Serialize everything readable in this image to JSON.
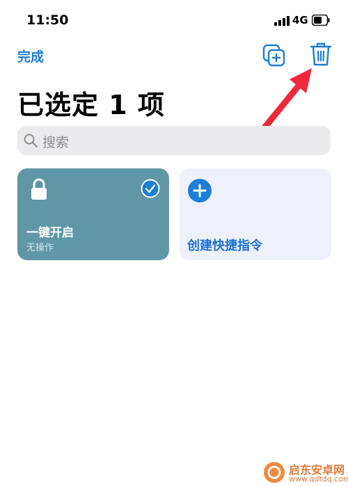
{
  "status_bar": {
    "time": "11:50",
    "network": "4G"
  },
  "header": {
    "done_label": "完成",
    "duplicate_icon": "duplicate-icon",
    "delete_icon": "trash-icon"
  },
  "title": "已选定 1 项",
  "search": {
    "placeholder": "搜索"
  },
  "cards": [
    {
      "name": "一键开启",
      "subtitle": "无操作",
      "icon": "lock-icon",
      "selected": true,
      "color": "#5f97a6"
    },
    {
      "name": "创建快捷指令",
      "icon": "plus-icon",
      "color": "#eef1fa"
    }
  ],
  "watermark": {
    "name": "启东安卓网",
    "url": "www.qdtdq.com"
  },
  "colors": {
    "accent": "#1c7ed6",
    "arrow": "#f0283a"
  }
}
